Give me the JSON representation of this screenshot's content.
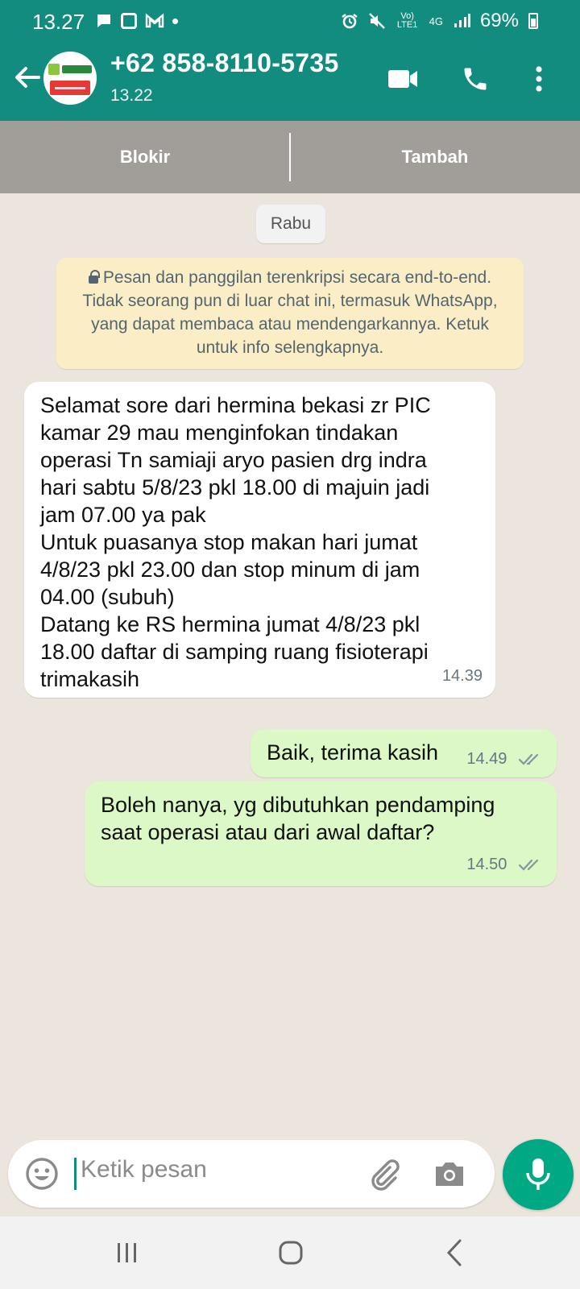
{
  "status_bar": {
    "time": "13.27",
    "network": "Vo) LTE1",
    "net_type": "4G",
    "battery": "69%"
  },
  "header": {
    "contact": "+62 858-8110-5735",
    "subtitle": "13.22"
  },
  "actions": {
    "block": "Blokir",
    "add": "Tambah"
  },
  "chat": {
    "date_chip": "Rabu",
    "encryption_notice": "Pesan dan panggilan terenkripsi secara end-to-end. Tidak seorang pun di luar chat ini, termasuk WhatsApp, yang dapat membaca atau mendengarkannya. Ketuk untuk info selengkapnya.",
    "messages": [
      {
        "direction": "incoming",
        "lines": [
          "Selamat sore dari hermina bekasi zr PIC",
          "kamar 29 mau menginfokan tindakan",
          "operasi Tn samiaji aryo pasien drg indra",
          "hari sabtu 5/8/23 pkl 18.00 di majuin jadi",
          "jam 07.00 ya pak",
          "Untuk puasanya stop makan hari jumat",
          "4/8/23 pkl 23.00 dan stop minum di jam",
          "04.00 (subuh)",
          "Datang ke RS hermina jumat 4/8/23 pkl",
          "18.00 daftar di samping ruang fisioterapi",
          "trimakasih"
        ],
        "time": "14.39"
      },
      {
        "direction": "outgoing",
        "text": "Baik, terima kasih",
        "time": "14.49",
        "status": "read"
      },
      {
        "direction": "outgoing",
        "lines": [
          "Boleh nanya, yg dibutuhkan pendamping",
          "saat operasi atau dari awal daftar?"
        ],
        "time": "14.50",
        "status": "read"
      }
    ]
  },
  "input": {
    "placeholder": "Ketik pesan"
  },
  "colors": {
    "header": "#128c7e",
    "chat_bg": "#ece5dd",
    "incoming": "#ffffff",
    "outgoing": "#dcf8c6",
    "mic": "#00a884",
    "tick": "#8696a0"
  },
  "icons": {
    "back": "arrow-back-icon",
    "video": "video-call-icon",
    "call": "phone-icon",
    "menu": "more-vertical-icon",
    "emoji": "emoji-icon",
    "attach": "attach-icon",
    "camera": "camera-icon",
    "mic": "mic-icon"
  }
}
